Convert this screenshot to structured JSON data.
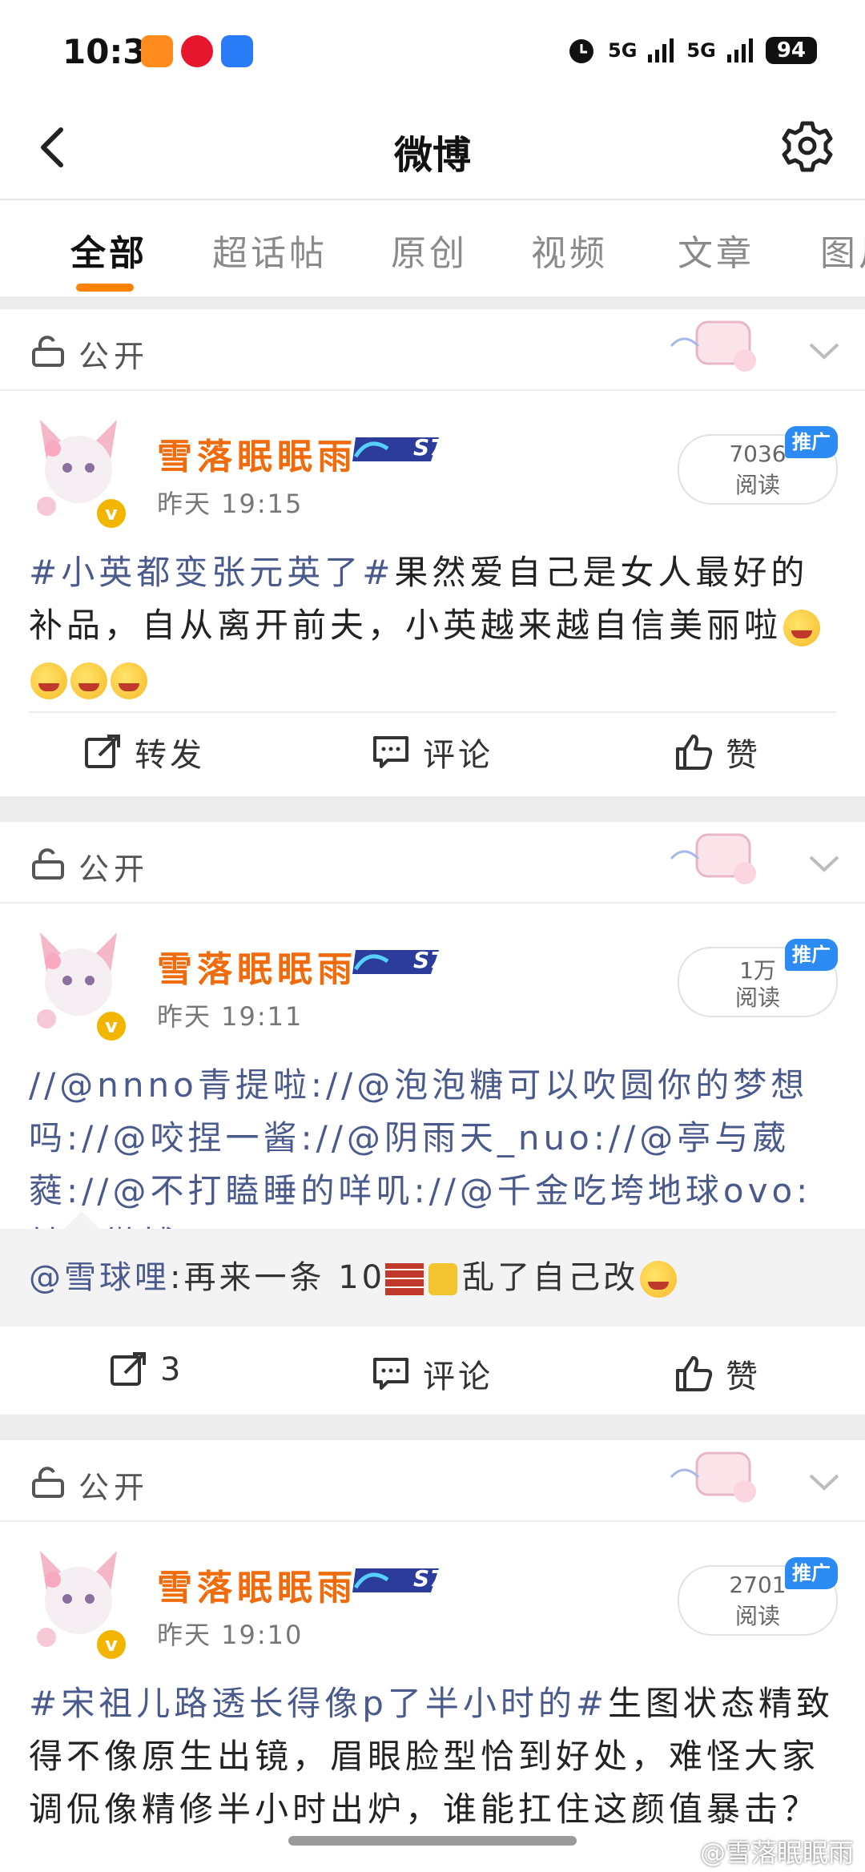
{
  "status_bar": {
    "time": "10:36",
    "battery": "94",
    "signal1": "5G",
    "signal2": "5G"
  },
  "header": {
    "title": "微博"
  },
  "tabs": [
    "全部",
    "超话帖",
    "原创",
    "视频",
    "文章",
    "图片"
  ],
  "cards": [
    {
      "visibility": "公开",
      "user": "雪落眠眠雨",
      "level": "S7",
      "time": "昨天 19:15",
      "reads_num": "7036",
      "reads_label": "阅读",
      "promo": "推广",
      "topic": "#小英都变张元英了#",
      "text": "果然爱自己是女人最好的补品，自从离开前夫，小英越来越自信美丽啦",
      "actions": {
        "forward": "转发",
        "comment": "评论",
        "like": "赞"
      }
    },
    {
      "visibility": "公开",
      "user": "雪落眠眠雨",
      "level": "S7",
      "time": "昨天 19:11",
      "reads_num": "1万",
      "reads_label": "阅读",
      "promo": "推广",
      "text": "//@nnno青提啦://@泡泡糖可以吹圆你的梦想吗://@咬捏一酱://@阴雨天_nuo://@亭与葳蕤://@不打瞌睡的咩叽://@千金吃垮地球ovo:转发微博",
      "quote_user": "@雪球哩",
      "quote_text": ":再来一条 10",
      "quote_tail": "乱了自己改",
      "actions": {
        "forward": "3",
        "comment": "评论",
        "like": "赞"
      }
    },
    {
      "visibility": "公开",
      "user": "雪落眠眠雨",
      "level": "S7",
      "time": "昨天 19:10",
      "reads_num": "2701",
      "reads_label": "阅读",
      "promo": "推广",
      "topic": "#宋祖儿路透长得像p了半小时的#",
      "text": "生图状态精致得不像原生出镜，眉眼脸型恰到好处，难怪大家调侃像精修半小时出炉，谁能扛住这颜值暴击？"
    }
  ],
  "watermark": "@雪落眠眠雨"
}
